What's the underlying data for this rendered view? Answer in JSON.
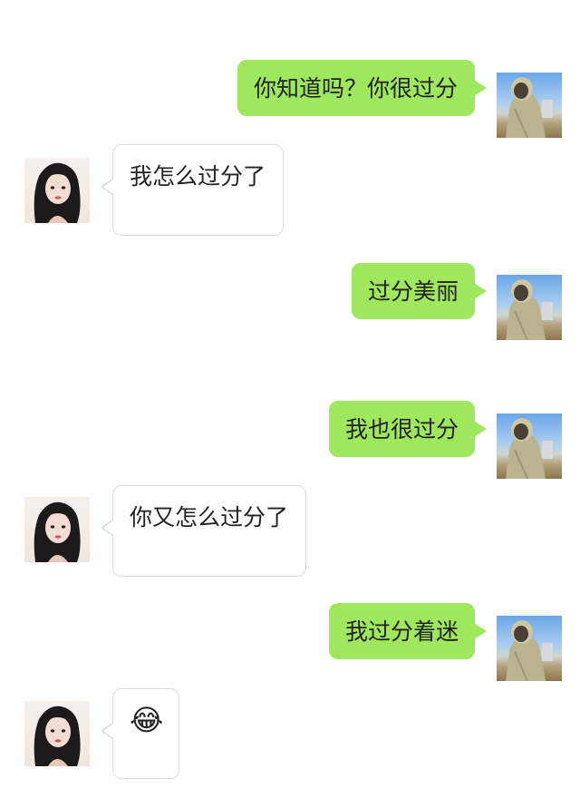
{
  "chat": {
    "messages": [
      {
        "sender": "me",
        "text": "你知道吗？你很过分",
        "avatar": "boy-hoodie-avatar"
      },
      {
        "sender": "her",
        "text": "我怎么过分了",
        "avatar": "girl-avatar"
      },
      {
        "sender": "me",
        "text": "过分美丽",
        "avatar": "boy-hoodie-avatar"
      },
      {
        "sender": "me",
        "text": "我也很过分",
        "avatar": "boy-hoodie-avatar"
      },
      {
        "sender": "her",
        "text": "你又怎么过分了",
        "avatar": "girl-avatar"
      },
      {
        "sender": "me",
        "text": "我过分着迷",
        "avatar": "boy-hoodie-avatar"
      },
      {
        "sender": "her",
        "text": "😂",
        "icon": "laughing-tears-emoji",
        "avatar": "girl-avatar"
      }
    ]
  },
  "colors": {
    "sent_bubble": "#9fe75c",
    "received_bubble": "#ffffff",
    "received_border": "#dcdcdc",
    "background": "#ffffff"
  }
}
